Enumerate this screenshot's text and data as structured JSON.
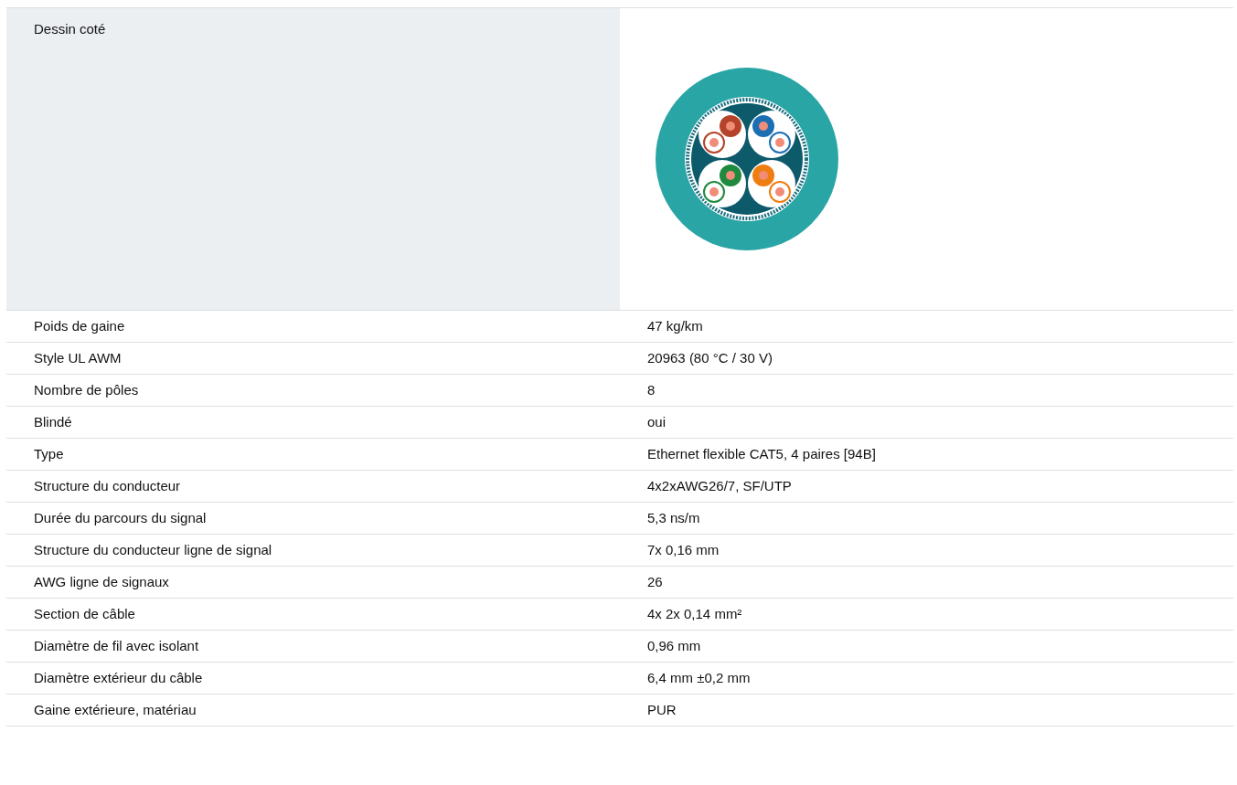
{
  "drawing_row": {
    "label": "Dessin coté"
  },
  "rows": [
    {
      "label": "Poids de gaine",
      "value": "47 kg/km"
    },
    {
      "label": "Style UL AWM",
      "value": "20963 (80 °C / 30 V)"
    },
    {
      "label": "Nombre de pôles",
      "value": "8"
    },
    {
      "label": "Blindé",
      "value": "oui"
    },
    {
      "label": "Type",
      "value": "Ethernet flexible CAT5, 4 paires [94B]"
    },
    {
      "label": "Structure du conducteur",
      "value": "4x2xAWG26/7, SF/UTP"
    },
    {
      "label": "Durée du parcours du signal",
      "value": "5,3 ns/m"
    },
    {
      "label": "Structure du conducteur ligne de signal",
      "value": "7x 0,16 mm"
    },
    {
      "label": "AWG ligne de signaux",
      "value": "26"
    },
    {
      "label": "Section de câble",
      "value": "4x 2x 0,14 mm²"
    },
    {
      "label": "Diamètre de fil avec isolant",
      "value": "0,96 mm"
    },
    {
      "label": "Diamètre extérieur du câble",
      "value": "6,4 mm ±0,2 mm"
    },
    {
      "label": "Gaine extérieure, matériau",
      "value": "PUR"
    }
  ]
}
